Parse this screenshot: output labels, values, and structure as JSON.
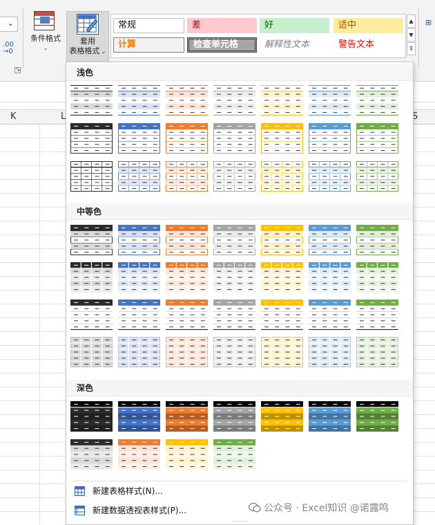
{
  "ribbon": {
    "conditional_format": {
      "label": "条件格式"
    },
    "format_as_table": {
      "label_line1": "套用",
      "label_line2": "表格格式"
    },
    "number_format_icon": "decrease-decimal-icon",
    "cell_styles": [
      {
        "id": "normal",
        "label": "常规"
      },
      {
        "id": "bad",
        "label": "差"
      },
      {
        "id": "good",
        "label": "好"
      },
      {
        "id": "neutral",
        "label": "适中"
      },
      {
        "id": "calculation",
        "label": "计算"
      },
      {
        "id": "check-cell",
        "label": "检查单元格"
      },
      {
        "id": "explanatory",
        "label": "解释性文本"
      },
      {
        "id": "warning",
        "label": "警告文本"
      }
    ]
  },
  "sheet": {
    "columns": [
      "K",
      "L",
      "S"
    ]
  },
  "gallery": {
    "sections": [
      {
        "title": "浅色",
        "key": "light"
      },
      {
        "title": "中等色",
        "key": "medium"
      },
      {
        "title": "深色",
        "key": "dark"
      }
    ],
    "menu": {
      "new_table_style": "新建表格样式(N)...",
      "new_pivot_style": "新建数据透视表样式(P)..."
    },
    "palette": {
      "black": "#2b2b2b",
      "blue": "#4472c4",
      "orange": "#ed7d31",
      "gray": "#a5a5a5",
      "gold": "#ffc000",
      "lightblue": "#5b9bd5",
      "green": "#70ad47"
    }
  },
  "watermark": {
    "text": "公众号 · Excel知识 @诺露鸣"
  }
}
